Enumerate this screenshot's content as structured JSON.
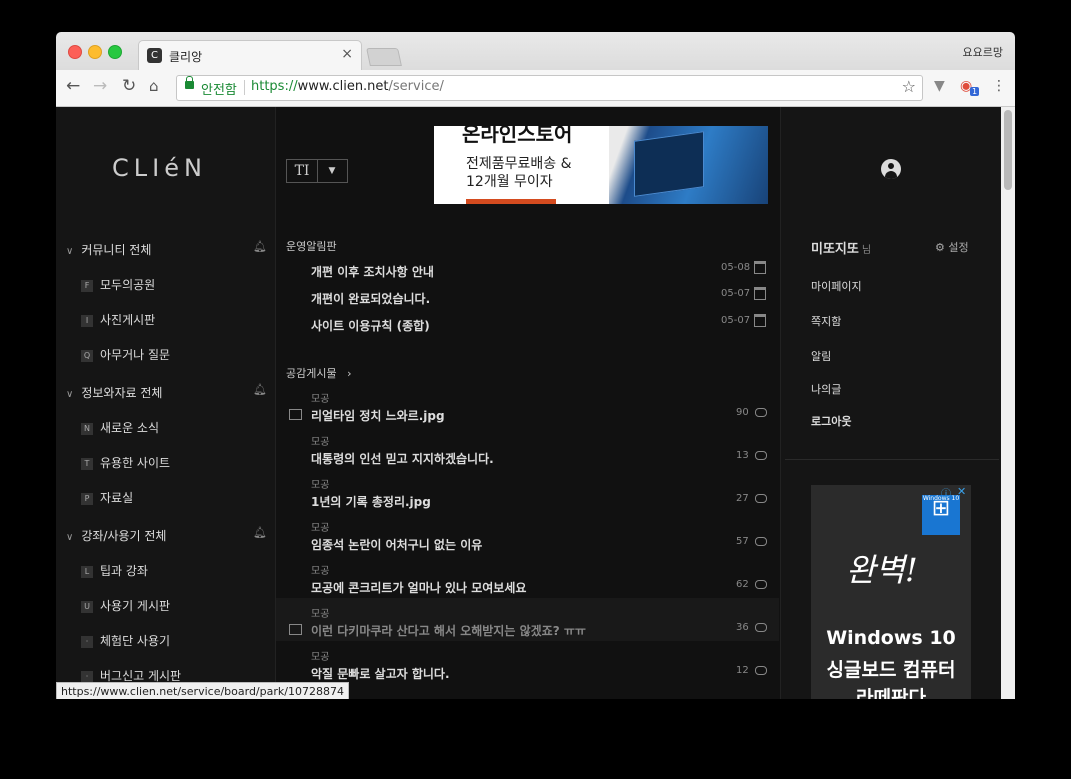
{
  "browser": {
    "tab_title": "클리앙",
    "tab_favicon": "C",
    "tab_close": "×",
    "profile_name": "요요르망",
    "secure_label": "안전함",
    "url_scheme": "https://",
    "url_host": "www.clien.net",
    "url_path": "/service/",
    "status_url": "https://www.clien.net/service/board/park/10728874",
    "extension_badge": "1"
  },
  "site": {
    "logo": "CLIéN",
    "font_toggle": "TI"
  },
  "banner_ad": {
    "title": "온라인스토어",
    "line1": "전제품무료배송 &",
    "line2": "12개월 무이자"
  },
  "sidebar": {
    "categories": [
      {
        "label": "커뮤니티 전체",
        "boards": [
          {
            "icon": "F",
            "label": "모두의공원"
          },
          {
            "icon": "I",
            "label": "사진게시판"
          },
          {
            "icon": "Q",
            "label": "아무거나 질문"
          }
        ]
      },
      {
        "label": "정보와자료 전체",
        "boards": [
          {
            "icon": "N",
            "label": "새로운 소식"
          },
          {
            "icon": "T",
            "label": "유용한 사이트"
          },
          {
            "icon": "P",
            "label": "자료실"
          }
        ]
      },
      {
        "label": "강좌/사용기 전체",
        "boards": [
          {
            "icon": "L",
            "label": "팁과 강좌"
          },
          {
            "icon": "U",
            "label": "사용기 게시판"
          },
          {
            "icon": "·",
            "label": "체험단 사용기"
          },
          {
            "icon": "·",
            "label": "버그신고 게시판"
          }
        ]
      }
    ]
  },
  "notices": {
    "heading": "운영알림판",
    "items": [
      {
        "title": "개편 이후 조치사항 안내",
        "date": "05-08"
      },
      {
        "title": "개편이 완료되었습니다.",
        "date": "05-07"
      },
      {
        "title": "사이트 이용규칙 (종합)",
        "date": "05-07"
      }
    ]
  },
  "hot_posts": {
    "heading": "공감게시물",
    "heading_arrow": "›",
    "items": [
      {
        "board": "모공",
        "title": "리얼타임 정치 느와르.jpg",
        "count": "90",
        "has_image": true
      },
      {
        "board": "모공",
        "title": "대통령의 인선 믿고 지지하겠습니다.",
        "count": "13",
        "has_image": false
      },
      {
        "board": "모공",
        "title": "1년의 기록 총정리.jpg",
        "count": "27",
        "has_image": false
      },
      {
        "board": "모공",
        "title": "임종석 논란이 어처구니 없는 이유",
        "count": "57",
        "has_image": false
      },
      {
        "board": "모공",
        "title": "모공에 콘크리트가 얼마나 있나 모여보세요",
        "count": "62",
        "has_image": false
      },
      {
        "board": "모공",
        "title": "이런 다키마쿠라 산다고 해서 오해받지는 않겠죠? ㅠㅠ",
        "count": "36",
        "has_image": true
      },
      {
        "board": "모공",
        "title": "악질 문빠로 살고자 합니다.",
        "count": "12",
        "has_image": false
      }
    ]
  },
  "user_panel": {
    "username": "미또지또",
    "suffix": "님",
    "settings_label": "설정",
    "links": [
      "마이페이지",
      "쪽지함",
      "알림",
      "나의글",
      "로그아웃"
    ]
  },
  "side_ad": {
    "badge": "Windows 10",
    "script_text": "완벽!",
    "line1": "Windows 10",
    "line2": "싱글보드 컴퓨터",
    "line3": "라떼판다",
    "info": "ⓘ",
    "close": "✕"
  }
}
